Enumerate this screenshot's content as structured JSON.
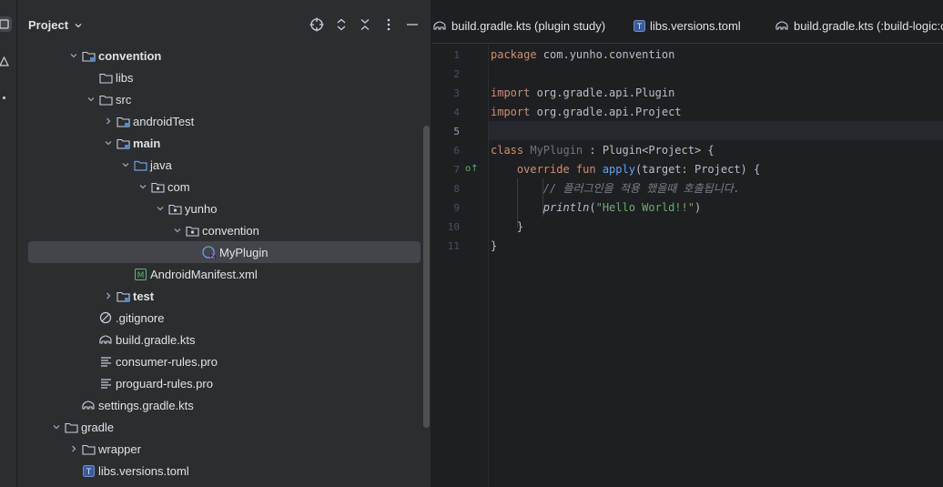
{
  "project_panel": {
    "title": "Project",
    "tree": [
      {
        "label": "convention",
        "bold": true
      },
      {
        "label": "libs"
      },
      {
        "label": "src"
      },
      {
        "label": "androidTest"
      },
      {
        "label": "main",
        "bold": true
      },
      {
        "label": "java"
      },
      {
        "label": "com"
      },
      {
        "label": "yunho"
      },
      {
        "label": "convention"
      },
      {
        "label": "MyPlugin",
        "selected": true
      },
      {
        "label": "AndroidManifest.xml"
      },
      {
        "label": "test",
        "bold": true
      },
      {
        "label": ".gitignore"
      },
      {
        "label": "build.gradle.kts"
      },
      {
        "label": "consumer-rules.pro"
      },
      {
        "label": "proguard-rules.pro"
      },
      {
        "label": "settings.gradle.kts"
      },
      {
        "label": "gradle"
      },
      {
        "label": "wrapper"
      },
      {
        "label": "libs.versions.toml"
      }
    ]
  },
  "editor": {
    "tabs": [
      {
        "label": "build.gradle.kts (plugin study)"
      },
      {
        "label": "libs.versions.toml"
      },
      {
        "label": "build.gradle.kts (:build-logic:c"
      }
    ],
    "line_numbers": [
      "1",
      "2",
      "3",
      "4",
      "5",
      "6",
      "7",
      "8",
      "9",
      "10",
      "11"
    ],
    "code": {
      "l1_kw": "package",
      "l1_rest": " com.yunho.convention",
      "l3_kw": "import",
      "l3_rest": " org.gradle.api.Plugin",
      "l4_kw": "import",
      "l4_rest": " org.gradle.api.Project",
      "l6_kw": "class",
      "l6_cls": " MyPlugin",
      "l6_rest": " : Plugin<Project> {",
      "l7_kw": "    override fun",
      "l7_fn": " apply",
      "l7_rest": "(target: Project) {",
      "l8_cm": "        // 플러그인을 적용 했을때 호출됩니다.",
      "l9_it": "        println",
      "l9_p1": "(",
      "l9_str": "\"Hello World!!\"",
      "l9_p2": ")",
      "l10": "    }",
      "l11": "}"
    }
  }
}
